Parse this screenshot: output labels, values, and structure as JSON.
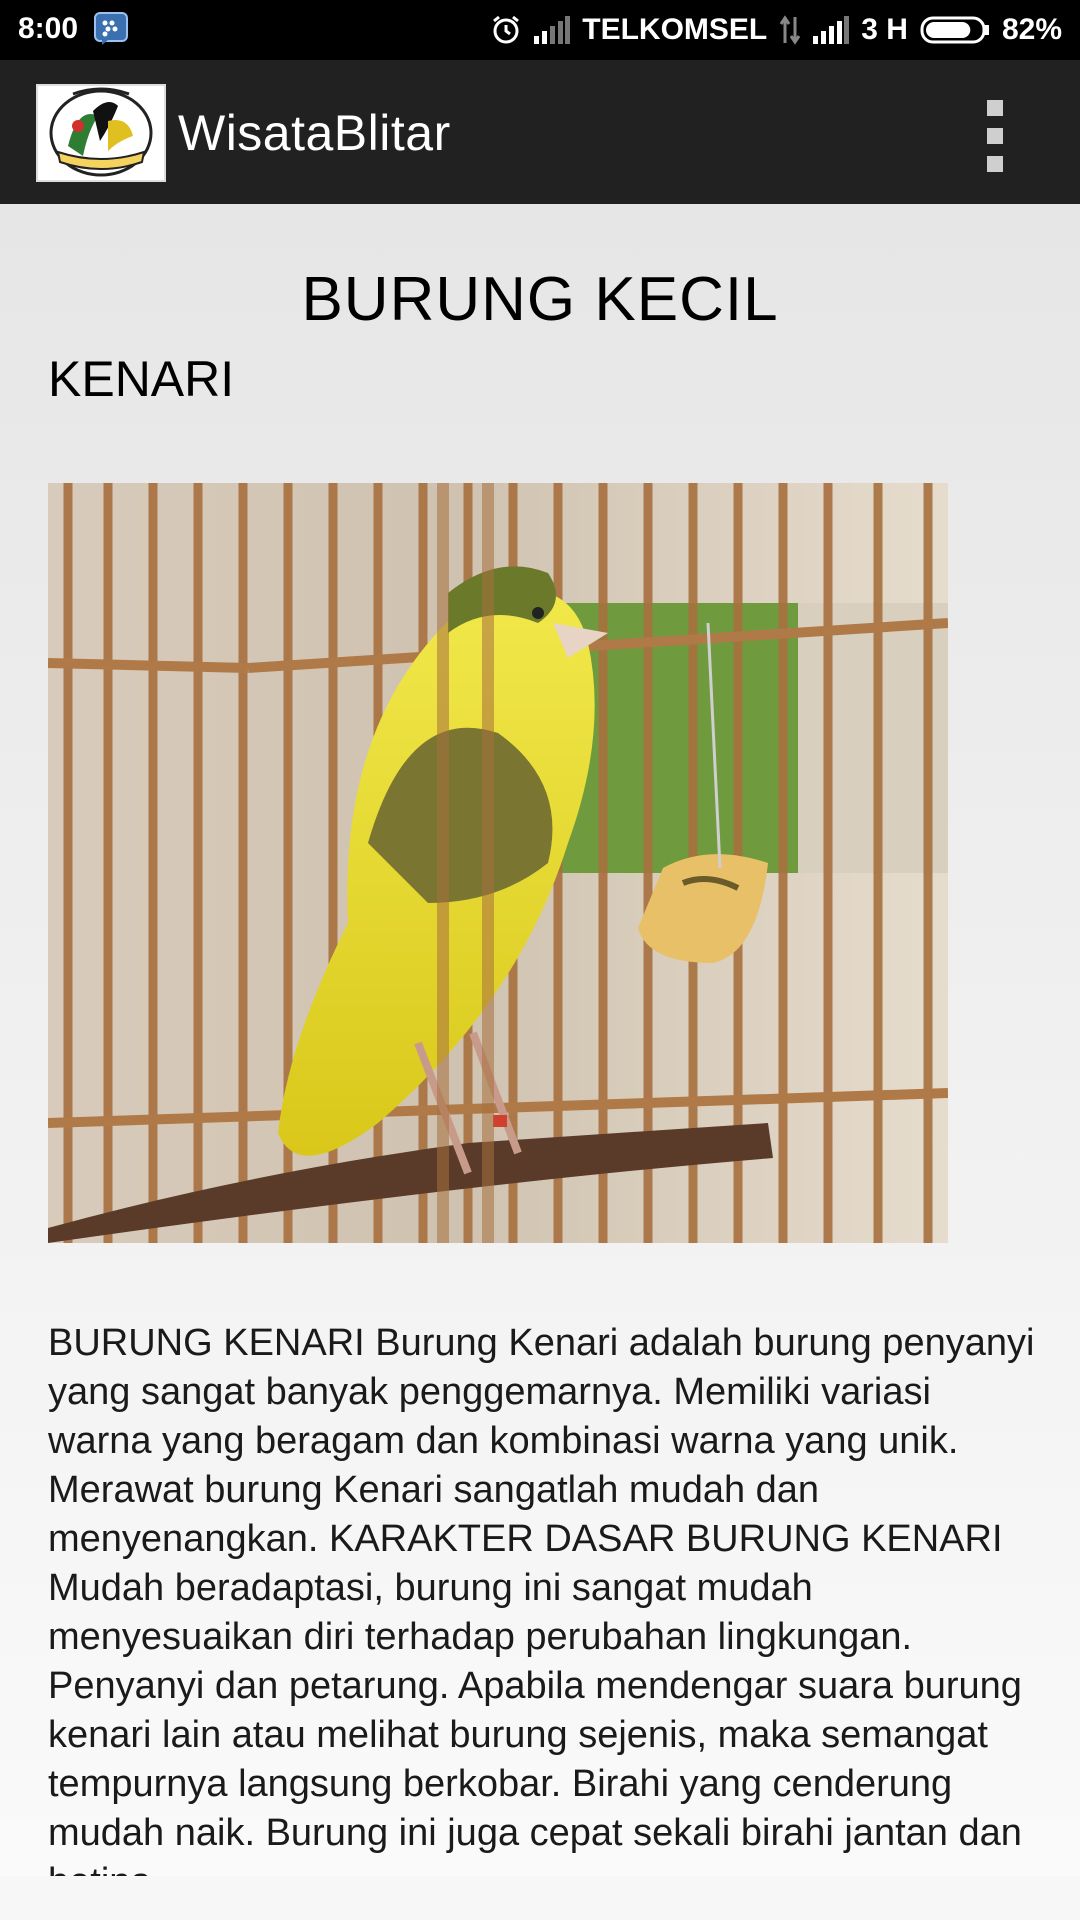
{
  "status_bar": {
    "time": "8:00",
    "carrier": "TELKOMSEL",
    "network": "3 H",
    "battery": "82%",
    "battery_level": 0.82,
    "icons": [
      "bbm-icon",
      "alarm-icon",
      "signal-icon",
      "data-arrows-icon",
      "signal-icon",
      "battery-icon"
    ]
  },
  "app_bar": {
    "title": "WisataBlitar",
    "logo_icon": "bird-club-logo",
    "menu_icon": "overflow-menu-icon"
  },
  "article": {
    "heading": "BURUNG KECIL",
    "subheading": "KENARI",
    "image": "canary-in-cage-photo",
    "body": "BURUNG KENARI Burung Kenari adalah burung penyanyi yang sangat banyak penggemarnya. Memiliki variasi warna yang beragam dan kombinasi warna yang unik. Merawat burung Kenari sangatlah mudah dan menyenangkan. KARAKTER DASAR BURUNG KENARI Mudah beradaptasi, burung ini sangat mudah menyesuaikan diri terhadap perubahan lingkungan. Penyanyi dan petarung. Apabila mendengar suara burung kenari lain atau melihat burung sejenis, maka semangat tempurnya langsung berkobar. Birahi yang cenderung mudah naik. Burung ini juga cepat sekali birahi jantan dan betina."
  },
  "colors": {
    "status_bar": "#000000",
    "app_bar": "#212121",
    "background": "#f3f3f3",
    "text": "#1a1a1a"
  }
}
